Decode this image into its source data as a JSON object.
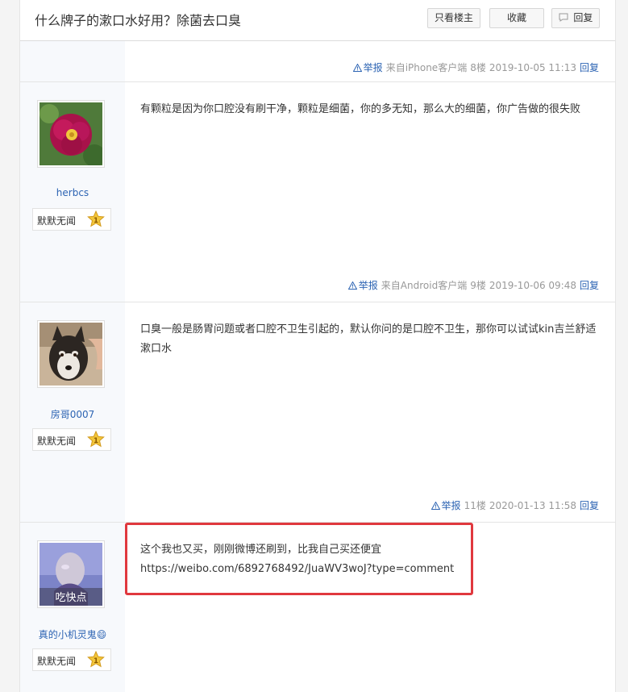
{
  "header": {
    "title": "什么牌子的漱口水好用？除菌去口臭",
    "btn_only": "只看楼主",
    "btn_fav": "收藏",
    "btn_reply": "回复"
  },
  "post0": {
    "report": "举报",
    "client": "来自iPhone客户端",
    "floor": "8楼",
    "time": "2019-10-05 11:13",
    "reply": "回复"
  },
  "post1": {
    "username": "herbcs",
    "badge": "默默无闻",
    "level": "1",
    "content": "有颗粒是因为你口腔没有刷干净，颗粒是细菌，你的多无知，那么大的细菌，你广告做的很失败",
    "report": "举报",
    "client": "来自Android客户端",
    "floor": "9楼",
    "time": "2019-10-06 09:48",
    "reply": "回复"
  },
  "post2": {
    "username": "房哥0007",
    "badge": "默默无闻",
    "level": "1",
    "content": "口臭一般是肠胃问题或者口腔不卫生引起的，默认你问的是口腔不卫生，那你可以试试kin吉兰舒适漱口水",
    "report": "举报",
    "floor": "11楼",
    "time": "2020-01-13 11:58",
    "reply": "回复"
  },
  "post3": {
    "username": "真的小机灵鬼😄",
    "avatar_text": "吃快点",
    "badge": "默默无闻",
    "level": "1",
    "content_line1": "这个我也又买，刚刚微博还刷到，比我自己买还便宜",
    "content_line2": "https://weibo.com/6892768492/JuaWV3woJ?type=comment"
  },
  "colors": {
    "link": "#2d64b3",
    "highlight_border": "#e0383e",
    "left_column_bg": "#f7f9fc"
  }
}
